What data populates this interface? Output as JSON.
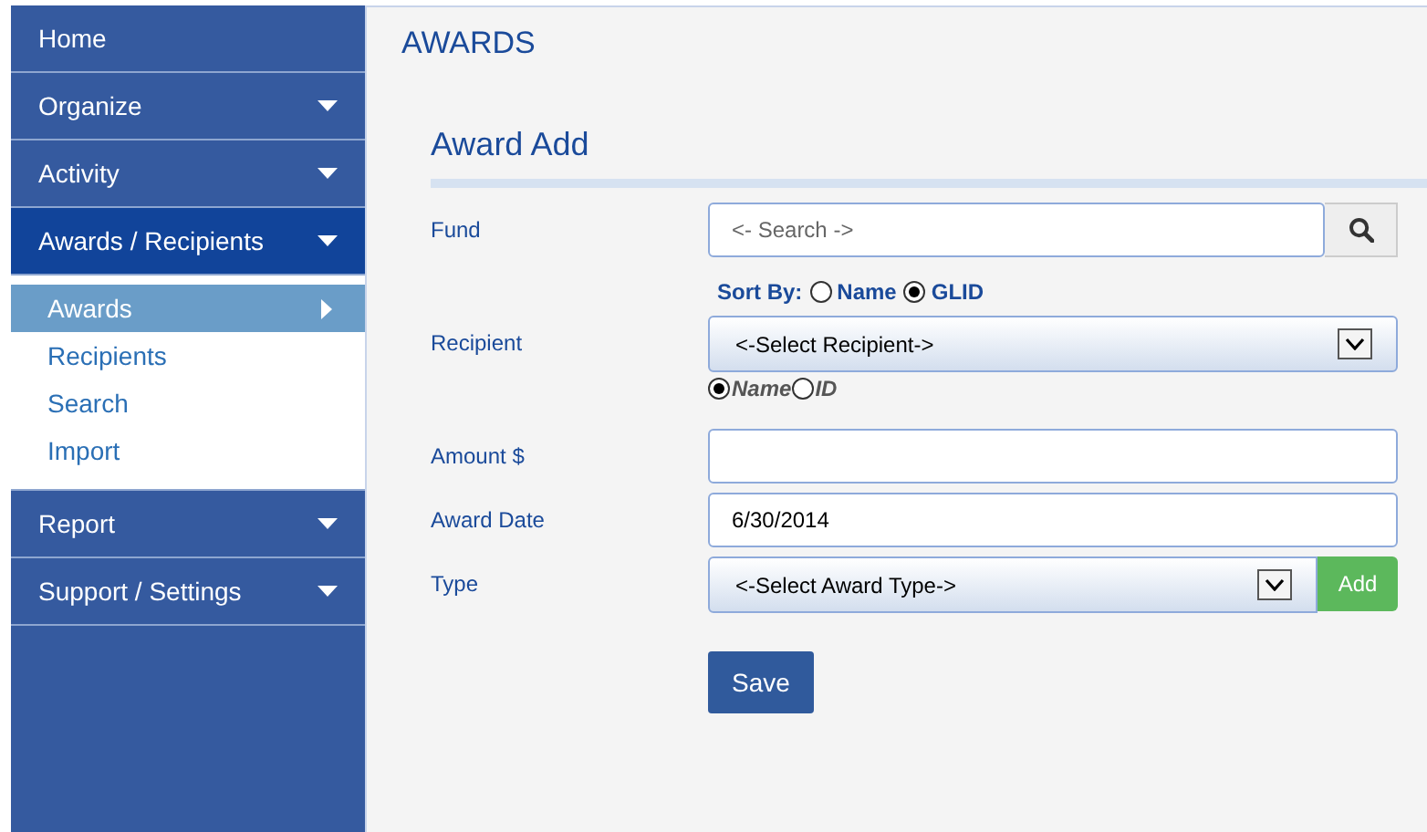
{
  "sidebar": {
    "items": [
      {
        "label": "Home",
        "kind": "link",
        "selected": false
      },
      {
        "label": "Organize",
        "kind": "menu",
        "selected": false
      },
      {
        "label": "Activity",
        "kind": "menu",
        "selected": false
      },
      {
        "label": "Awards / Recipients",
        "kind": "menu",
        "selected": true,
        "expanded": true,
        "children": [
          {
            "label": "Awards",
            "selected": true
          },
          {
            "label": "Recipients",
            "selected": false
          },
          {
            "label": "Search",
            "selected": false
          },
          {
            "label": "Import",
            "selected": false
          }
        ]
      },
      {
        "label": "Report",
        "kind": "menu",
        "selected": false
      },
      {
        "label": "Support / Settings",
        "kind": "menu",
        "selected": false
      }
    ]
  },
  "page_title": "AWARDS",
  "form": {
    "title": "Award Add",
    "fund": {
      "label": "Fund",
      "placeholder": "<- Search ->"
    },
    "sort_by": {
      "label": "Sort By:",
      "options": [
        {
          "label": "Name",
          "selected": false
        },
        {
          "label": "GLID",
          "selected": true
        }
      ]
    },
    "recipient": {
      "label": "Recipient",
      "value": "<-Select Recipient->",
      "options": [
        {
          "label": "Name",
          "selected": true
        },
        {
          "label": "ID",
          "selected": false
        }
      ]
    },
    "amount": {
      "label": "Amount $"
    },
    "award_date": {
      "label": "Award Date",
      "value": "6/30/2014"
    },
    "type": {
      "label": "Type",
      "value": "<-Select Award Type->",
      "add_button": "Add"
    },
    "save_button": "Save"
  }
}
